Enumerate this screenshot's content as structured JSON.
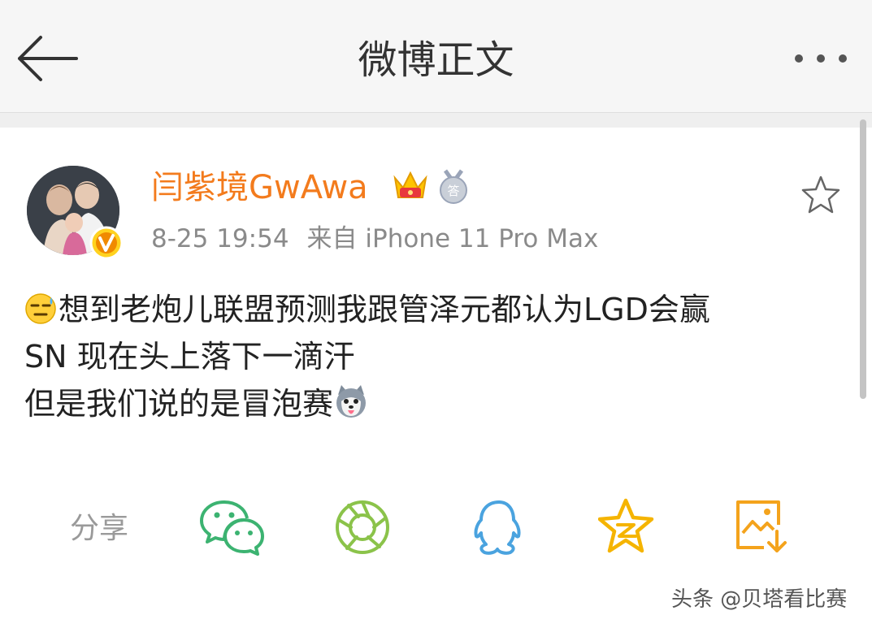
{
  "header": {
    "title": "微博正文",
    "back_icon": "arrow-left-icon",
    "more_icon": "more-dots-icon"
  },
  "post": {
    "author": {
      "name": "闫紫境GwAwa",
      "verified_badge": "verified-v-icon",
      "badges": [
        "crown-icon",
        "medal-icon"
      ]
    },
    "time": "8-25 19:54",
    "source": "来自 iPhone 11 Pro Max",
    "content_lines": [
      "想到老炮儿联盟预测我跟管泽元都认为LGD会赢",
      "SN 现在头上落下一滴汗",
      "但是我们说的是冒泡赛"
    ],
    "emojis": [
      "sweat-emoji",
      "husky-emoji"
    ]
  },
  "share": {
    "label": "分享",
    "targets": [
      "wechat-icon",
      "moments-icon",
      "qq-icon",
      "qzone-icon",
      "save-image-icon"
    ]
  },
  "watermark": "头条 @贝塔看比赛",
  "colors": {
    "username": "#f37b1d",
    "wechat": "#3cb371",
    "moments": "#8bc34a",
    "qq": "#4aa3df",
    "qzone": "#f5b400",
    "save": "#f4a31c"
  }
}
